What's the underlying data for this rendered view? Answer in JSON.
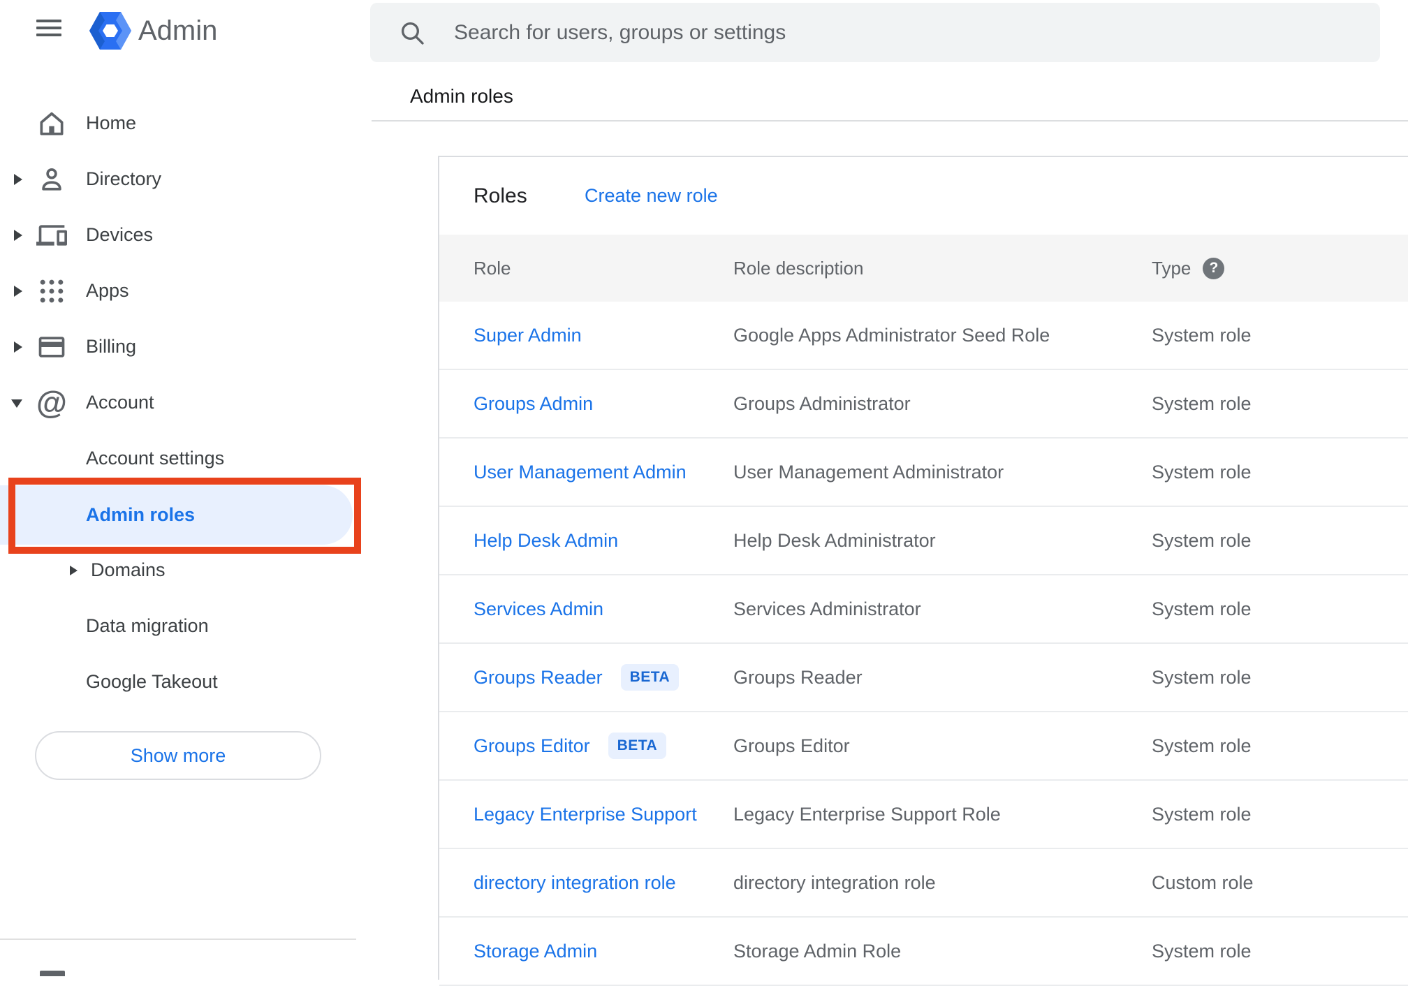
{
  "app": {
    "title": "Admin"
  },
  "header": {
    "search_placeholder": "Search for users, groups or settings"
  },
  "breadcrumb": "Admin roles",
  "sidebar": {
    "items": [
      {
        "label": "Home",
        "expandable": false
      },
      {
        "label": "Directory",
        "expandable": true
      },
      {
        "label": "Devices",
        "expandable": true
      },
      {
        "label": "Apps",
        "expandable": true
      },
      {
        "label": "Billing",
        "expandable": true
      },
      {
        "label": "Account",
        "expandable": true,
        "expanded": true
      }
    ],
    "sub_items": {
      "account_settings": "Account settings",
      "admin_roles": "Admin roles",
      "domains": "Domains",
      "data_migration": "Data migration",
      "google_takeout": "Google Takeout"
    },
    "selected_item": "Admin roles",
    "show_more_label": "Show more"
  },
  "main": {
    "title": "Roles",
    "create_link": "Create new role",
    "table": {
      "columns": [
        "Role",
        "Role description",
        "Type"
      ],
      "help_glyph": "?",
      "beta_label": "BETA",
      "rows": [
        {
          "role": "Super Admin",
          "beta": false,
          "description": "Google Apps Administrator Seed Role",
          "type": "System role"
        },
        {
          "role": "Groups Admin",
          "beta": false,
          "description": "Groups Administrator",
          "type": "System role"
        },
        {
          "role": "User Management Admin",
          "beta": false,
          "description": "User Management Administrator",
          "type": "System role"
        },
        {
          "role": "Help Desk Admin",
          "beta": false,
          "description": "Help Desk Administrator",
          "type": "System role"
        },
        {
          "role": "Services Admin",
          "beta": false,
          "description": "Services Administrator",
          "type": "System role"
        },
        {
          "role": "Groups Reader",
          "beta": true,
          "description": "Groups Reader",
          "type": "System role"
        },
        {
          "role": "Groups Editor",
          "beta": true,
          "description": "Groups Editor",
          "type": "System role"
        },
        {
          "role": "Legacy Enterprise Support",
          "beta": false,
          "description": "Legacy Enterprise Support Role",
          "type": "System role"
        },
        {
          "role": "directory integration role",
          "beta": false,
          "description": "directory integration role",
          "type": "Custom role"
        },
        {
          "role": "Storage Admin",
          "beta": false,
          "description": "Storage Admin Role",
          "type": "System role"
        }
      ]
    }
  },
  "colors": {
    "accent": "#1a73e8",
    "annotation": "#e8421c",
    "selected_bg": "#e8f0fe",
    "band": "#f5f5f5",
    "text_primary": "#202124",
    "text_secondary": "#5f6368",
    "divider": "#dadce0"
  }
}
